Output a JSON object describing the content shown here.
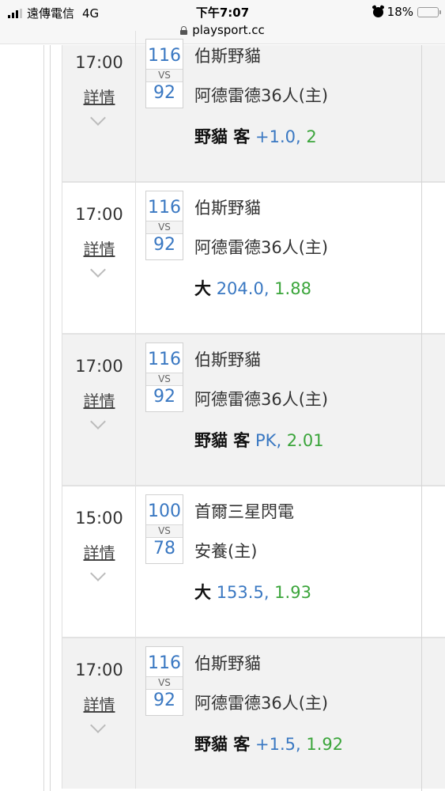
{
  "status_bar": {
    "carrier": "遠傳電信",
    "network": "4G",
    "time": "下午7:07",
    "url": "playsport.cc",
    "battery": "18%",
    "battery_level_pct": 18
  },
  "games": [
    {
      "time": "17:00",
      "detail": "詳情",
      "score_home": "116",
      "vs": "VS",
      "score_away": "92",
      "team1": "伯斯野貓",
      "team2": "阿德雷德36人(主)",
      "pick": "野貓 客",
      "line": "+1.0",
      "odds": "2"
    },
    {
      "time": "17:00",
      "detail": "詳情",
      "score_home": "116",
      "vs": "VS",
      "score_away": "92",
      "team1": "伯斯野貓",
      "team2": "阿德雷德36人(主)",
      "pick": "大",
      "line": "204.0",
      "odds": "1.88"
    },
    {
      "time": "17:00",
      "detail": "詳情",
      "score_home": "116",
      "vs": "VS",
      "score_away": "92",
      "team1": "伯斯野貓",
      "team2": "阿德雷德36人(主)",
      "pick": "野貓 客",
      "line": "PK",
      "odds": "2.01"
    },
    {
      "time": "15:00",
      "detail": "詳情",
      "score_home": "100",
      "vs": "VS",
      "score_away": "78",
      "team1": "首爾三星閃電",
      "team2": "安養(主)",
      "pick": "大",
      "line": "153.5",
      "odds": "1.93"
    },
    {
      "time": "17:00",
      "detail": "詳情",
      "score_home": "116",
      "vs": "VS",
      "score_away": "92",
      "team1": "伯斯野貓",
      "team2": "阿德雷德36人(主)",
      "pick": "野貓 客",
      "line": "+1.5",
      "odds": "1.92"
    }
  ],
  "colors": {
    "score": "#3a78c2",
    "line": "#3a78c2",
    "odds": "#3ba53b",
    "row_grey": "#f2f2f2",
    "battery_low": "#e02020"
  }
}
